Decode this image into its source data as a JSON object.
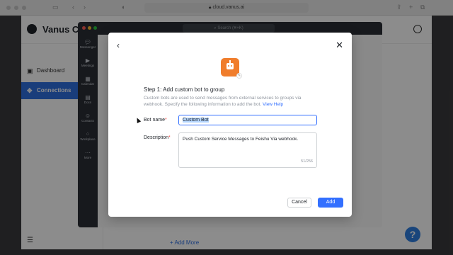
{
  "browser": {
    "url": "cloud.vanus.ai"
  },
  "vanus": {
    "brand": "Vanus Cl",
    "nav": [
      {
        "label": "Dashboard"
      },
      {
        "label": "Connections"
      }
    ],
    "add_more": "+ Add More",
    "help_icon": "?"
  },
  "feishu": {
    "search_placeholder": "Search (⌘+K)",
    "sidebar": [
      {
        "label": "Messenger",
        "icon": "chat-icon"
      },
      {
        "label": "Meetings",
        "icon": "video-icon"
      },
      {
        "label": "Calendar",
        "icon": "calendar-icon"
      },
      {
        "label": "Docs",
        "icon": "doc-icon"
      },
      {
        "label": "Contacts",
        "icon": "contacts-icon"
      },
      {
        "label": "Workplace",
        "icon": "grid-icon"
      },
      {
        "label": "More",
        "icon": "more-icon"
      }
    ]
  },
  "modal": {
    "title": "Step 1: Add custom bot to group",
    "description": "Custom bots are used to send messages from external services to groups via webhook. Specify the following information to add the bot.",
    "view_help": "View Help",
    "bot_name_label": "Bot name",
    "bot_name_value": "Custom Bot",
    "description_label": "Description",
    "description_value": "Push Custom Service Messages to Feishu Via webhook.",
    "counter": "51/256",
    "required_mark": "*",
    "cancel_label": "Cancel",
    "add_label": "Add"
  }
}
